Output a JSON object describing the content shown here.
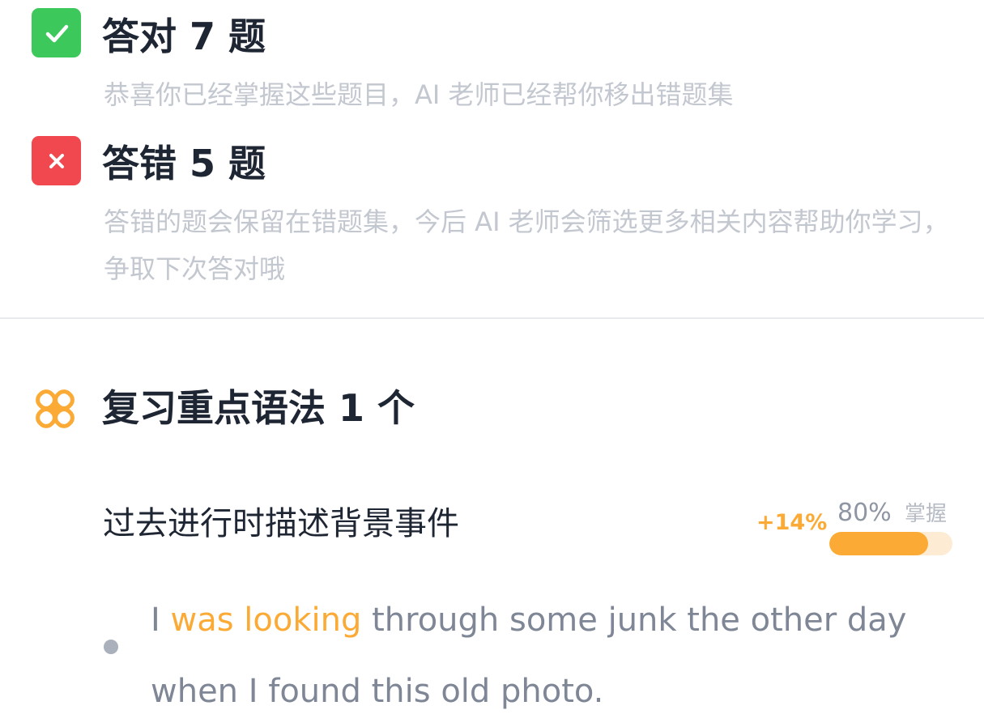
{
  "results": {
    "correct": {
      "title": "答对 7 题",
      "description": "恭喜你已经掌握这些题目，AI 老师已经帮你移出错题集",
      "icon": "checkmark-icon",
      "color": "#3cc85a"
    },
    "wrong": {
      "title": "答错 5 题",
      "description": "答错的题会保留在错题集，今后 AI 老师会筛选更多相关内容帮助你学习，争取下次答对哦",
      "icon": "cross-icon",
      "color": "#f0484e"
    }
  },
  "review": {
    "icon": "grammar-knot-icon",
    "title": "复习重点语法 1 个",
    "items": [
      {
        "name": "过去进行时描述背景事件",
        "delta": "+14%",
        "mastery_percent": "80%",
        "mastery_label": "掌握",
        "mastery_value": 0.8,
        "example": {
          "before": "I ",
          "highlight": "was looking",
          "after": " through some junk the other day when I found this old photo."
        }
      }
    ]
  },
  "colors": {
    "accent": "#fbaa35",
    "title_text": "#1f2633",
    "muted_text": "#c3c7cf"
  }
}
